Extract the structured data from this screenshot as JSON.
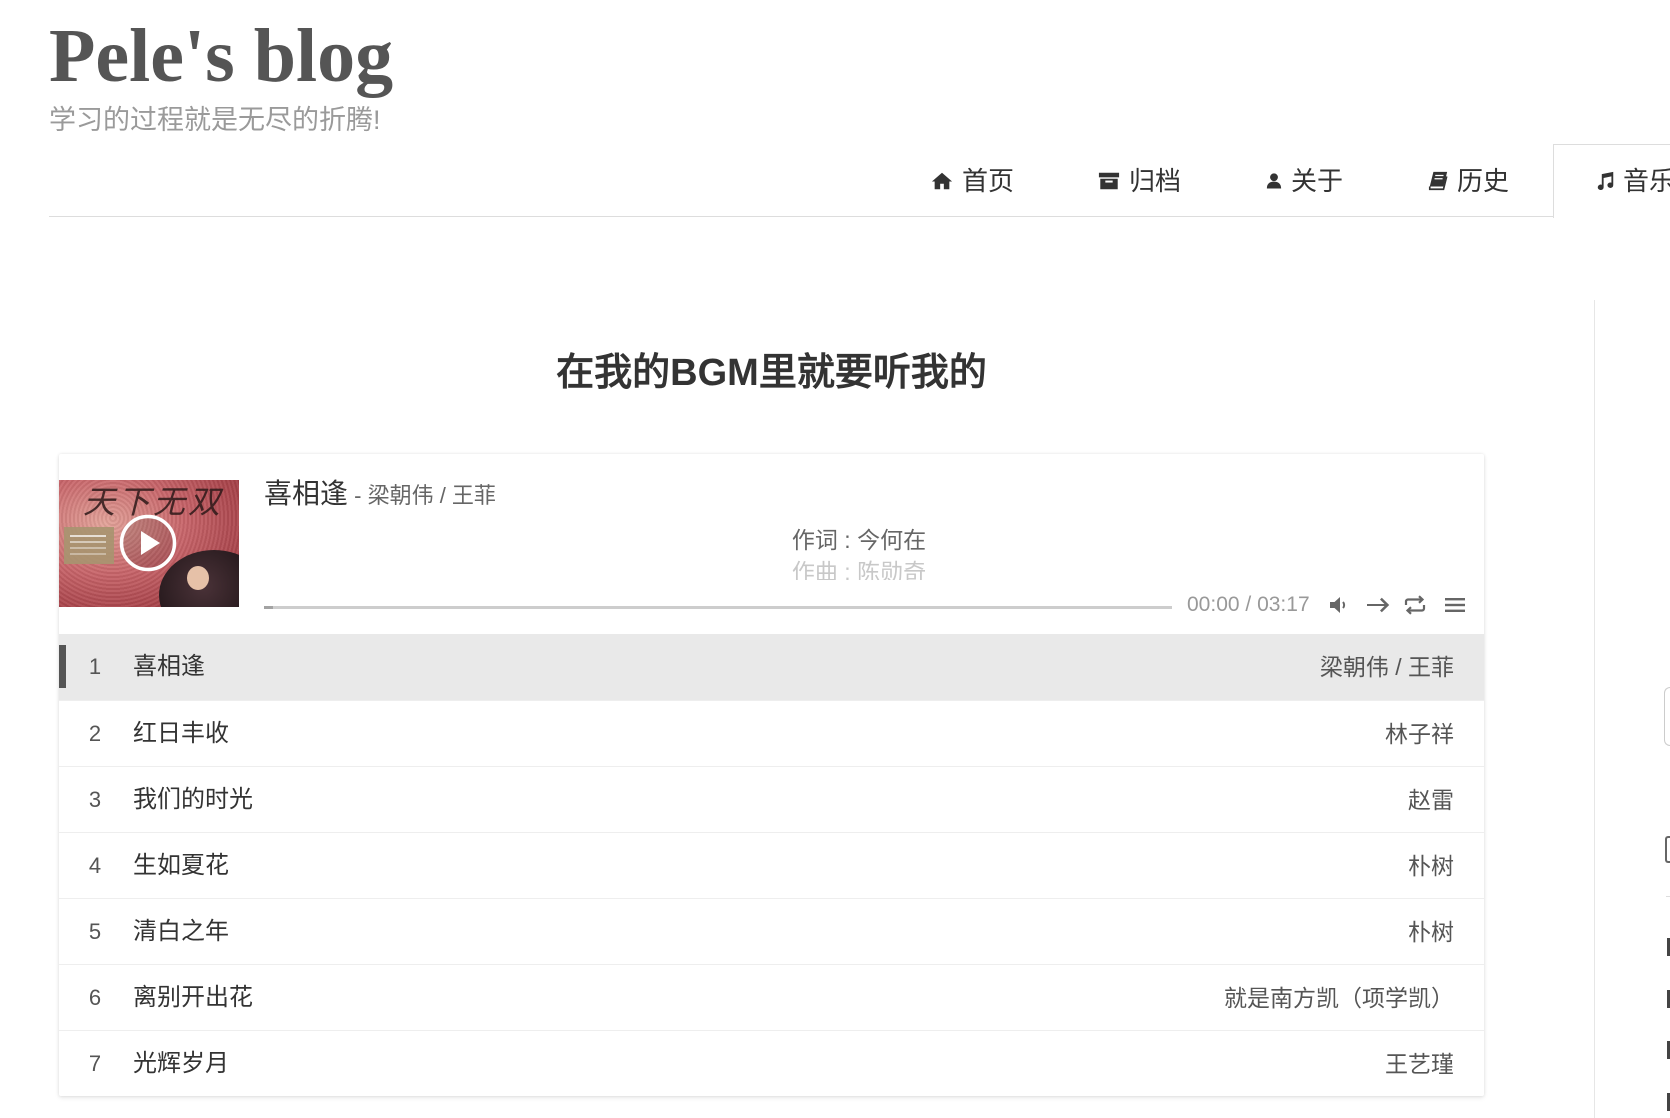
{
  "blog": {
    "title": "Pele's blog",
    "subtitle": "学习的过程就是无尽的折腾!"
  },
  "nav": {
    "items": [
      {
        "label": "首页",
        "icon": "home-icon"
      },
      {
        "label": "归档",
        "icon": "archive-icon"
      },
      {
        "label": "关于",
        "icon": "user-icon"
      },
      {
        "label": "历史",
        "icon": "book-icon"
      },
      {
        "label": "音乐",
        "icon": "music-icon",
        "active": true
      }
    ]
  },
  "page": {
    "heading": "在我的BGM里就要听我的"
  },
  "player": {
    "cover": {
      "artwork_text": "天下无双"
    },
    "current": {
      "title": "喜相逢",
      "separator": " - ",
      "artist": "梁朝伟 / 王菲"
    },
    "lyrics": [
      "作词 : 今何在",
      "作曲 : 陈勋奇"
    ],
    "progress": 0,
    "time": {
      "current": "00:00",
      "separator": " / ",
      "total": "03:17"
    },
    "controls": {
      "play": "play-icon",
      "volume": "volume-icon",
      "order": "order-icon",
      "loop": "loop-icon",
      "list": "menu-icon"
    }
  },
  "playlist": [
    {
      "index": "1",
      "title": "喜相逢",
      "artist": "梁朝伟 / 王菲",
      "active": true
    },
    {
      "index": "2",
      "title": "红日丰收",
      "artist": "林子祥"
    },
    {
      "index": "3",
      "title": "我们的时光",
      "artist": "赵雷"
    },
    {
      "index": "4",
      "title": "生如夏花",
      "artist": "朴树"
    },
    {
      "index": "5",
      "title": "清白之年",
      "artist": "朴树"
    },
    {
      "index": "6",
      "title": "离别开出花",
      "artist": "就是南方凯（项学凯）"
    },
    {
      "index": "7",
      "title": "光辉岁月",
      "artist": "王艺瑾"
    }
  ],
  "colors": {
    "text": "#333333",
    "muted": "#999999",
    "active_row_bg": "#e9e9e9",
    "active_marker": "#555555"
  }
}
